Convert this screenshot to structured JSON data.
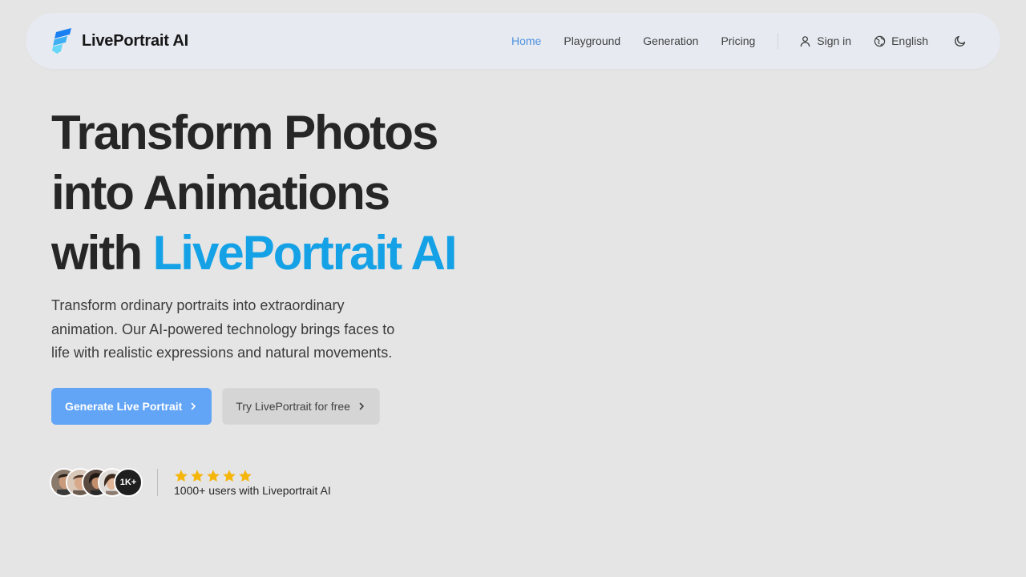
{
  "brand": {
    "name": "LivePortrait AI",
    "logo_icon": "liveportrait-logo-icon",
    "colors": {
      "top": "#1a7ff0",
      "middle": "#3db0f5",
      "bottom": "#67d6f7"
    }
  },
  "nav": {
    "links": [
      {
        "label": "Home",
        "active": true
      },
      {
        "label": "Playground",
        "active": false
      },
      {
        "label": "Generation",
        "active": false
      },
      {
        "label": "Pricing",
        "active": false
      }
    ],
    "sign_in": {
      "label": "Sign in",
      "icon": "user-icon"
    },
    "language": {
      "label": "English",
      "icon": "globe-icon"
    },
    "theme_toggle": {
      "icon": "moon-icon"
    }
  },
  "hero": {
    "title_line1": "Transform Photos",
    "title_line2": "into Animations",
    "title_line3_prefix": "with",
    "title_line3_accent": "LivePortrait AI",
    "description": "Transform ordinary portraits into extraordinary animation. Our AI-powered technology brings faces to life with realistic expressions and natural movements.",
    "primary_cta": "Generate Live Portrait",
    "secondary_cta": "Try LivePortrait for free"
  },
  "social_proof": {
    "avatar_count_label": "1K+",
    "star_count": 5,
    "rating_text": "1000+ users with Liveportrait AI"
  },
  "colors": {
    "accent": "#15a1e6",
    "active_link": "#4f93e0",
    "primary_button": "#62a5f6",
    "star": "#f5b50a",
    "background": "#e5e5e5",
    "navbar": "#e7eaf1"
  }
}
